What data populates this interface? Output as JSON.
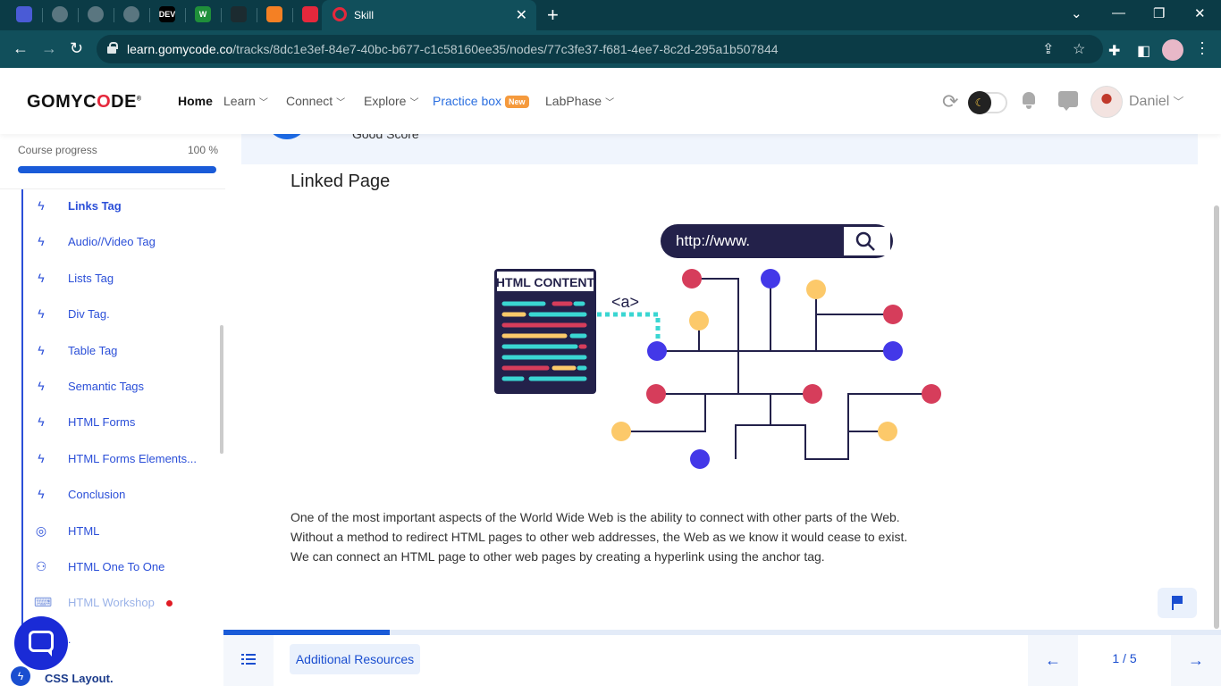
{
  "browser": {
    "active_tab_title": "Skill",
    "url_domain": "learn.gomycode.co",
    "url_path": "/tracks/8dc1e3ef-84e7-40bc-b677-c1c58160ee35/nodes/77c3fe37-f681-4ee7-8c2d-295a1b507844",
    "pinned_tabs": [
      {
        "name": "app-tab-icon",
        "color": "#4a5bd6",
        "glyph": ""
      },
      {
        "name": "globe-tab-icon",
        "color": "#5a7680",
        "glyph": ""
      },
      {
        "name": "globe-tab-icon",
        "color": "#5a7680",
        "glyph": ""
      },
      {
        "name": "globe-tab-icon",
        "color": "#5a7680",
        "glyph": ""
      },
      {
        "name": "dev-tab-icon",
        "color": "#000000",
        "glyph": "DEV"
      },
      {
        "name": "w-tab-icon",
        "color": "#1f8f3a",
        "glyph": "W"
      },
      {
        "name": "github-tab-icon",
        "color": "#1c2b30",
        "glyph": ""
      },
      {
        "name": "stackoverflow-tab-icon",
        "color": "#f48024",
        "glyph": ""
      },
      {
        "name": "shield-tab-icon",
        "color": "#e5283c",
        "glyph": ""
      }
    ]
  },
  "header": {
    "logo": {
      "part1": "GOMYC",
      "o": "O",
      "part2": "DE",
      "reg": "®"
    },
    "nav": {
      "home": "Home",
      "learn": "Learn",
      "connect": "Connect",
      "explore": "Explore",
      "practice": "Practice box",
      "practice_badge": "New",
      "labphase": "LabPhase"
    },
    "user_name": "Daniel"
  },
  "sidebar": {
    "progress_label": "Course progress",
    "progress_value": "100 %",
    "progress_fraction": 1.0,
    "items": [
      {
        "label": "Links Tag",
        "icon": "bolt-icon",
        "state": "active"
      },
      {
        "label": "Audio//Video Tag",
        "icon": "bolt-icon",
        "state": "normal"
      },
      {
        "label": "Lists Tag",
        "icon": "bolt-icon",
        "state": "normal"
      },
      {
        "label": "Div Tag.",
        "icon": "bolt-icon",
        "state": "normal"
      },
      {
        "label": "Table Tag",
        "icon": "bolt-icon",
        "state": "normal"
      },
      {
        "label": "Semantic Tags",
        "icon": "bolt-icon",
        "state": "normal"
      },
      {
        "label": "HTML Forms",
        "icon": "bolt-icon",
        "state": "normal"
      },
      {
        "label": "HTML Forms Elements...",
        "icon": "bolt-icon",
        "state": "normal"
      },
      {
        "label": "Conclusion",
        "icon": "bolt-icon",
        "state": "normal"
      },
      {
        "label": "HTML",
        "icon": "target-icon",
        "state": "normal"
      },
      {
        "label": "HTML One To One",
        "icon": "people-icon",
        "state": "normal"
      },
      {
        "label": "HTML Workshop",
        "icon": "workshop-icon",
        "state": "locked"
      }
    ],
    "dot_fragment": ".",
    "bottom_item": "CSS Layout."
  },
  "main": {
    "score_text": "Good Score",
    "title": "Linked Page",
    "illustration": {
      "url_text": "http://www.",
      "content_label": "HTML CONTENT",
      "anchor_tag": "<a>"
    },
    "paragraph": [
      "One of the most important aspects of the World Wide Web is the ability to connect with other parts of the Web.",
      "Without a method to redirect HTML pages to other web addresses, the Web as we know it would cease to exist.",
      "We can connect an HTML page to other web pages by creating a hyperlink using the anchor tag."
    ]
  },
  "bottom": {
    "resources_label": "Additional Resources",
    "page_indicator": "1 / 5",
    "progress_fraction": 0.167
  },
  "colors": {
    "brand_blue": "#1a4ed0",
    "brand_red": "#e5283c",
    "chrome_teal": "#114f5b",
    "node_red": "#d63d5b",
    "node_blue": "#4338e8",
    "node_yellow": "#fcc96a",
    "navy": "#23214a",
    "teal_line": "#3ad6d2"
  }
}
